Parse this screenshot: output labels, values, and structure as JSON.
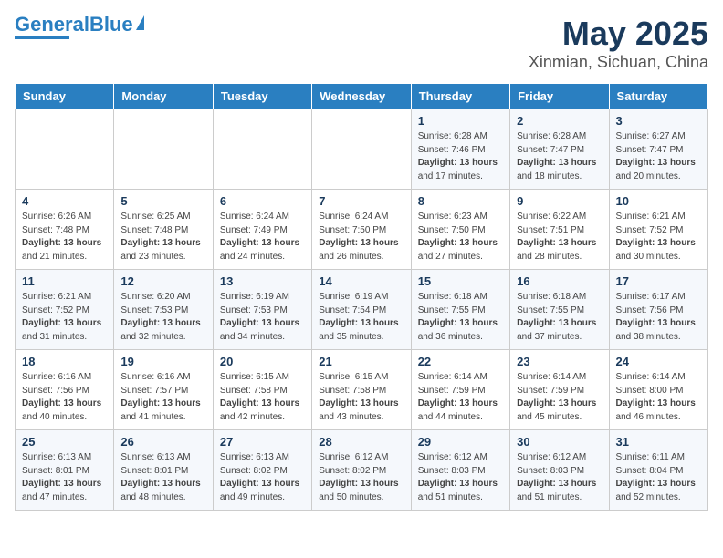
{
  "header": {
    "logo_general": "General",
    "logo_blue": "Blue",
    "title": "May 2025",
    "subtitle": "Xinmian, Sichuan, China"
  },
  "days_of_week": [
    "Sunday",
    "Monday",
    "Tuesday",
    "Wednesday",
    "Thursday",
    "Friday",
    "Saturday"
  ],
  "weeks": [
    [
      {
        "day": "",
        "info": ""
      },
      {
        "day": "",
        "info": ""
      },
      {
        "day": "",
        "info": ""
      },
      {
        "day": "",
        "info": ""
      },
      {
        "day": "1",
        "info": "Sunrise: 6:28 AM\nSunset: 7:46 PM\nDaylight: 13 hours\nand 17 minutes."
      },
      {
        "day": "2",
        "info": "Sunrise: 6:28 AM\nSunset: 7:47 PM\nDaylight: 13 hours\nand 18 minutes."
      },
      {
        "day": "3",
        "info": "Sunrise: 6:27 AM\nSunset: 7:47 PM\nDaylight: 13 hours\nand 20 minutes."
      }
    ],
    [
      {
        "day": "4",
        "info": "Sunrise: 6:26 AM\nSunset: 7:48 PM\nDaylight: 13 hours\nand 21 minutes."
      },
      {
        "day": "5",
        "info": "Sunrise: 6:25 AM\nSunset: 7:48 PM\nDaylight: 13 hours\nand 23 minutes."
      },
      {
        "day": "6",
        "info": "Sunrise: 6:24 AM\nSunset: 7:49 PM\nDaylight: 13 hours\nand 24 minutes."
      },
      {
        "day": "7",
        "info": "Sunrise: 6:24 AM\nSunset: 7:50 PM\nDaylight: 13 hours\nand 26 minutes."
      },
      {
        "day": "8",
        "info": "Sunrise: 6:23 AM\nSunset: 7:50 PM\nDaylight: 13 hours\nand 27 minutes."
      },
      {
        "day": "9",
        "info": "Sunrise: 6:22 AM\nSunset: 7:51 PM\nDaylight: 13 hours\nand 28 minutes."
      },
      {
        "day": "10",
        "info": "Sunrise: 6:21 AM\nSunset: 7:52 PM\nDaylight: 13 hours\nand 30 minutes."
      }
    ],
    [
      {
        "day": "11",
        "info": "Sunrise: 6:21 AM\nSunset: 7:52 PM\nDaylight: 13 hours\nand 31 minutes."
      },
      {
        "day": "12",
        "info": "Sunrise: 6:20 AM\nSunset: 7:53 PM\nDaylight: 13 hours\nand 32 minutes."
      },
      {
        "day": "13",
        "info": "Sunrise: 6:19 AM\nSunset: 7:53 PM\nDaylight: 13 hours\nand 34 minutes."
      },
      {
        "day": "14",
        "info": "Sunrise: 6:19 AM\nSunset: 7:54 PM\nDaylight: 13 hours\nand 35 minutes."
      },
      {
        "day": "15",
        "info": "Sunrise: 6:18 AM\nSunset: 7:55 PM\nDaylight: 13 hours\nand 36 minutes."
      },
      {
        "day": "16",
        "info": "Sunrise: 6:18 AM\nSunset: 7:55 PM\nDaylight: 13 hours\nand 37 minutes."
      },
      {
        "day": "17",
        "info": "Sunrise: 6:17 AM\nSunset: 7:56 PM\nDaylight: 13 hours\nand 38 minutes."
      }
    ],
    [
      {
        "day": "18",
        "info": "Sunrise: 6:16 AM\nSunset: 7:56 PM\nDaylight: 13 hours\nand 40 minutes."
      },
      {
        "day": "19",
        "info": "Sunrise: 6:16 AM\nSunset: 7:57 PM\nDaylight: 13 hours\nand 41 minutes."
      },
      {
        "day": "20",
        "info": "Sunrise: 6:15 AM\nSunset: 7:58 PM\nDaylight: 13 hours\nand 42 minutes."
      },
      {
        "day": "21",
        "info": "Sunrise: 6:15 AM\nSunset: 7:58 PM\nDaylight: 13 hours\nand 43 minutes."
      },
      {
        "day": "22",
        "info": "Sunrise: 6:14 AM\nSunset: 7:59 PM\nDaylight: 13 hours\nand 44 minutes."
      },
      {
        "day": "23",
        "info": "Sunrise: 6:14 AM\nSunset: 7:59 PM\nDaylight: 13 hours\nand 45 minutes."
      },
      {
        "day": "24",
        "info": "Sunrise: 6:14 AM\nSunset: 8:00 PM\nDaylight: 13 hours\nand 46 minutes."
      }
    ],
    [
      {
        "day": "25",
        "info": "Sunrise: 6:13 AM\nSunset: 8:01 PM\nDaylight: 13 hours\nand 47 minutes."
      },
      {
        "day": "26",
        "info": "Sunrise: 6:13 AM\nSunset: 8:01 PM\nDaylight: 13 hours\nand 48 minutes."
      },
      {
        "day": "27",
        "info": "Sunrise: 6:13 AM\nSunset: 8:02 PM\nDaylight: 13 hours\nand 49 minutes."
      },
      {
        "day": "28",
        "info": "Sunrise: 6:12 AM\nSunset: 8:02 PM\nDaylight: 13 hours\nand 50 minutes."
      },
      {
        "day": "29",
        "info": "Sunrise: 6:12 AM\nSunset: 8:03 PM\nDaylight: 13 hours\nand 51 minutes."
      },
      {
        "day": "30",
        "info": "Sunrise: 6:12 AM\nSunset: 8:03 PM\nDaylight: 13 hours\nand 51 minutes."
      },
      {
        "day": "31",
        "info": "Sunrise: 6:11 AM\nSunset: 8:04 PM\nDaylight: 13 hours\nand 52 minutes."
      }
    ]
  ]
}
